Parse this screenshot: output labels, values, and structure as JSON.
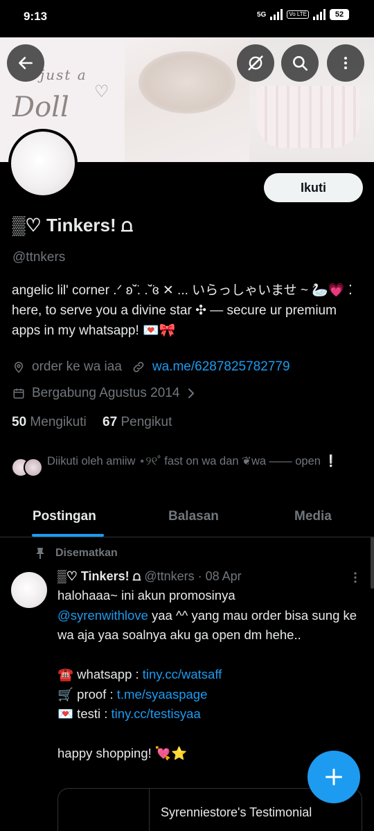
{
  "status_bar": {
    "time": "9:13",
    "network": "5G",
    "volte": "Vo LTE",
    "battery": "52"
  },
  "banner": {
    "line1": "just   a",
    "line2": "Doll",
    "heart": "♡"
  },
  "profile": {
    "display_name": "▒♡ Tinkers! ⩍",
    "handle": "@ttnkers",
    "follow_label": "Ikuti",
    "bio": "angelic lil' corner .ᐟ ʚ˘̈. .˘̈ɞ ✕    ... いらっしゃいませ ~ 🦢💗  ⁚ here, to serve you a divine star ✣ — secure ur premium apps in my whatsapp! 💌🎀",
    "location": "order ke wa iaa",
    "website": "wa.me/6287825782779",
    "joined": "Bergabung Agustus 2014",
    "following_count": "50",
    "following_label": "Mengikuti",
    "followers_count": "67",
    "followers_label": "Pengikut",
    "followed_by": "Diikuti oleh amiiw ⋆୨୧˚ fast on wa dan ❦wa —— open ❕"
  },
  "tabs": [
    "Postingan",
    "Balasan",
    "Media"
  ],
  "post": {
    "pinned_label": "Disematkan",
    "author": "▒♡ Tinkers! ⩍",
    "handle": "@ttnkers",
    "date": "· 08 Apr",
    "line1": "halohaaa~ ini akun promosinya",
    "mention": "@syrenwithlove",
    "line2": " yaa ^^ yang mau order bisa sung ke wa aja yaa soalnya aku ga open dm hehe..",
    "wa_label": "☎️ whatsapp : ",
    "wa_link": "tiny.cc/watsaff",
    "proof_label": "🛒 proof : ",
    "proof_link": "t.me/syaaspage",
    "testi_label": "💌 testi : ",
    "testi_link": "tiny.cc/testisyaa",
    "closing": "happy shopping! 💘⭐",
    "card_title": "Syrenniestore's Testimonial"
  },
  "icons": {
    "back": "arrow-left-icon",
    "grok": "grok-icon",
    "search": "search-icon",
    "more": "more-vertical-icon",
    "location": "location-pin-icon",
    "link": "link-icon",
    "calendar": "calendar-icon",
    "chevron": "chevron-right-icon",
    "pin": "pin-icon",
    "compose": "plus-icon"
  },
  "colors": {
    "accent": "#1d9bf0",
    "text": "#e7e9ea",
    "muted": "#71767b",
    "bg": "#000000"
  }
}
